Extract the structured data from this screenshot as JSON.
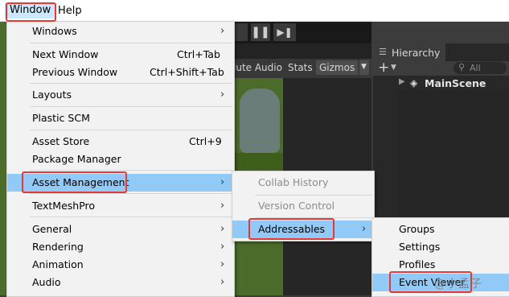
{
  "menubar": {
    "window_label": "Window",
    "help_label": "Help"
  },
  "window_menu": {
    "items": [
      {
        "label": "Windows",
        "shortcut": "",
        "submenu": true
      },
      {
        "label": "Next Window",
        "shortcut": "Ctrl+Tab",
        "submenu": false
      },
      {
        "label": "Previous Window",
        "shortcut": "Ctrl+Shift+Tab",
        "submenu": false
      },
      {
        "label": "Layouts",
        "shortcut": "",
        "submenu": true
      },
      {
        "label": "Plastic SCM",
        "shortcut": "",
        "submenu": false
      },
      {
        "label": "Asset Store",
        "shortcut": "Ctrl+9",
        "submenu": false
      },
      {
        "label": "Package Manager",
        "shortcut": "",
        "submenu": false
      },
      {
        "label": "Asset Management",
        "shortcut": "",
        "submenu": true
      },
      {
        "label": "TextMeshPro",
        "shortcut": "",
        "submenu": true
      },
      {
        "label": "General",
        "shortcut": "",
        "submenu": true
      },
      {
        "label": "Rendering",
        "shortcut": "",
        "submenu": true
      },
      {
        "label": "Animation",
        "shortcut": "",
        "submenu": true
      },
      {
        "label": "Audio",
        "shortcut": "",
        "submenu": true
      }
    ]
  },
  "asset_management_menu": {
    "items": [
      {
        "label": "Collab History",
        "disabled": true
      },
      {
        "label": "Version Control",
        "disabled": true
      },
      {
        "label": "Addressables",
        "submenu": true
      }
    ]
  },
  "addressables_menu": {
    "items": [
      {
        "label": "Groups"
      },
      {
        "label": "Settings"
      },
      {
        "label": "Profiles"
      },
      {
        "label": "Event Viewer"
      }
    ]
  },
  "scene_toolbar": {
    "mute_audio": "lute Audio",
    "stats": "Stats",
    "gizmos": "Gizmos"
  },
  "hierarchy": {
    "tab_label": "Hierarchy",
    "search_placeholder": "All",
    "scene_name": "MainScene"
  },
  "watermark": "@小孟子",
  "icons": {
    "pause": "pause-icon",
    "step": "step-icon",
    "hierarchy": "hierarchy-icon",
    "add": "plus-icon",
    "search": "search-icon",
    "unity": "unity-icon",
    "submenu": "chevron-right-icon"
  },
  "colors": {
    "highlight": "#91c9f7",
    "annotation": "#e53935",
    "menu_bg": "#f2f2f2"
  }
}
